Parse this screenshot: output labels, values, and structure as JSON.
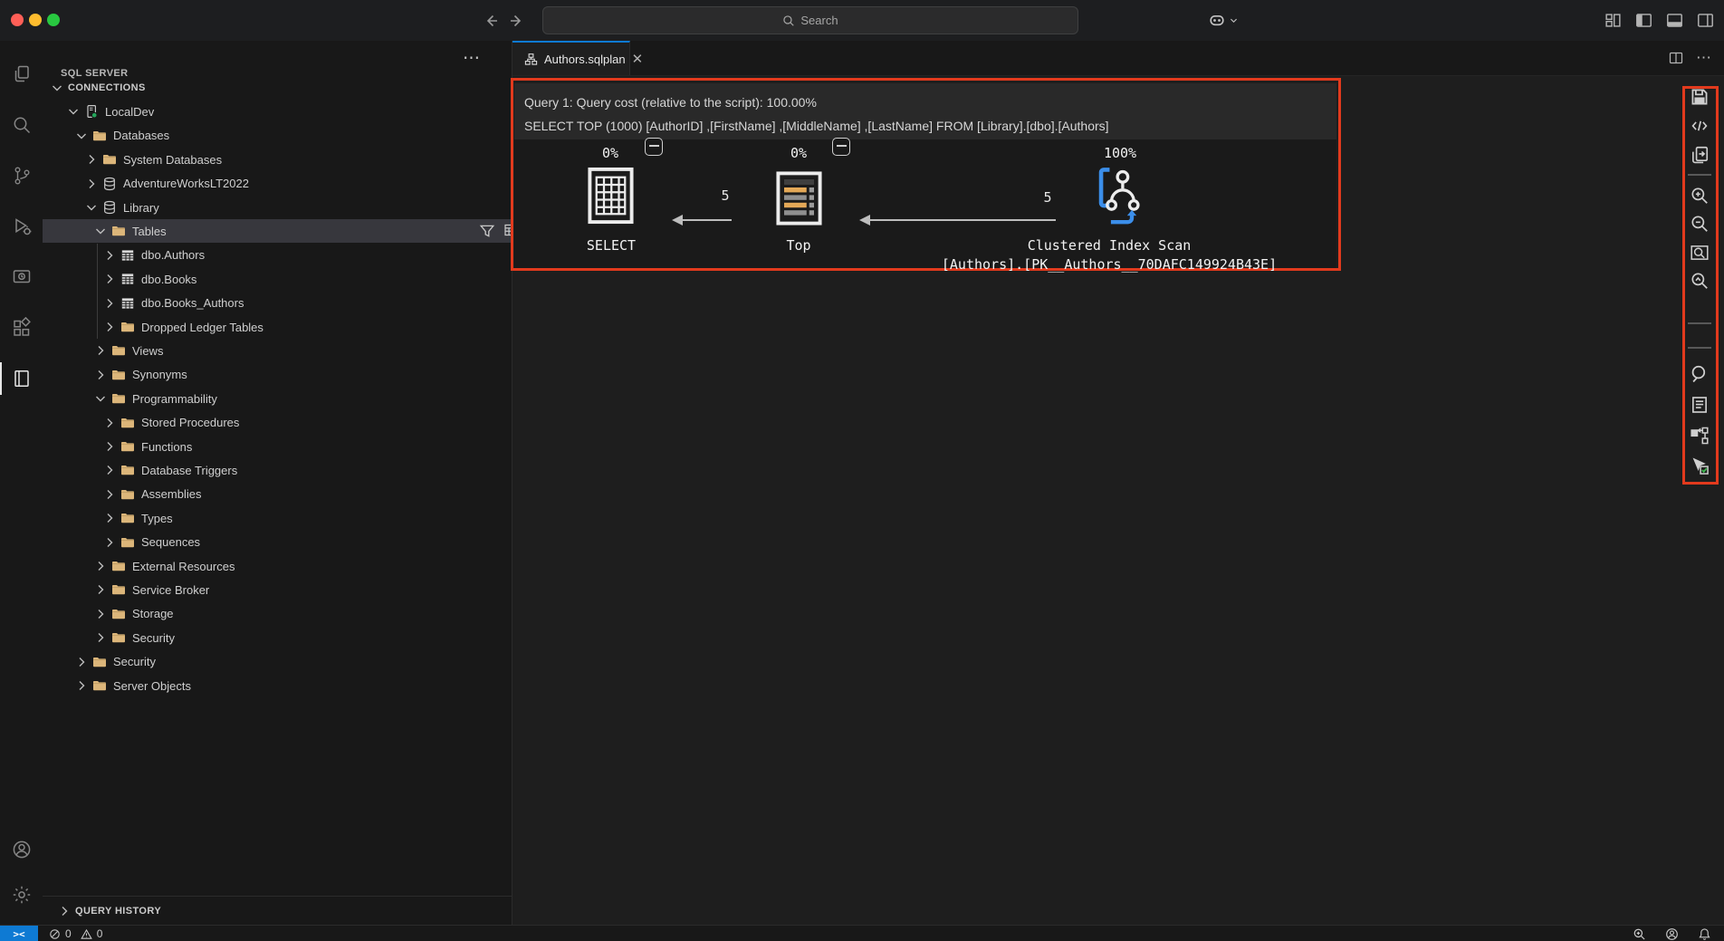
{
  "colors": {
    "annotation_red": "#e23a1d",
    "accent_blue": "#0e7ad3",
    "folder_tan": "#dcb67a",
    "connected_green": "#23a55a",
    "scan_blue": "#3b8eea"
  },
  "titlebar": {
    "search_placeholder": "Search",
    "traffic_lights": [
      "close",
      "minimize",
      "zoom"
    ],
    "right_icons": [
      "customize-layout",
      "toggle-primary-sidebar",
      "toggle-panel",
      "toggle-secondary-sidebar"
    ],
    "copilot": "copilot-menu"
  },
  "activity_bar": {
    "items": [
      {
        "name": "connections",
        "active": false
      },
      {
        "name": "search",
        "active": false
      },
      {
        "name": "source-control",
        "active": false
      },
      {
        "name": "run-and-debug",
        "active": false
      },
      {
        "name": "task-history",
        "active": false
      },
      {
        "name": "extensions",
        "active": false
      },
      {
        "name": "notebooks",
        "active": true
      }
    ],
    "bottom_items": [
      {
        "name": "accounts"
      },
      {
        "name": "settings"
      }
    ]
  },
  "sidebar": {
    "title": "SQL SERVER",
    "tree": [
      {
        "label": "CONNECTIONS",
        "level": 0,
        "expand": "down",
        "icon": null,
        "section": true
      },
      {
        "label": "LocalDev",
        "level": 1,
        "expand": "down",
        "icon": "server"
      },
      {
        "label": "Databases",
        "level": 2,
        "expand": "down",
        "icon": "folder"
      },
      {
        "label": "System Databases",
        "level": 3,
        "expand": "right",
        "icon": "folder"
      },
      {
        "label": "AdventureWorksLT2022",
        "level": 3,
        "expand": "right",
        "icon": "database"
      },
      {
        "label": "Library",
        "level": 3,
        "expand": "down",
        "icon": "database"
      },
      {
        "label": "Tables",
        "level": 4,
        "expand": "down",
        "icon": "folder",
        "selected": true,
        "actions": true
      },
      {
        "label": "dbo.Authors",
        "level": 5,
        "expand": "right",
        "icon": "table"
      },
      {
        "label": "dbo.Books",
        "level": 5,
        "expand": "right",
        "icon": "table"
      },
      {
        "label": "dbo.Books_Authors",
        "level": 5,
        "expand": "right",
        "icon": "table"
      },
      {
        "label": "Dropped Ledger Tables",
        "level": 5,
        "expand": "right",
        "icon": "folder"
      },
      {
        "label": "Views",
        "level": 4,
        "expand": "right",
        "icon": "folder"
      },
      {
        "label": "Synonyms",
        "level": 4,
        "expand": "right",
        "icon": "folder"
      },
      {
        "label": "Programmability",
        "level": 4,
        "expand": "down",
        "icon": "folder"
      },
      {
        "label": "Stored Procedures",
        "level": 5,
        "expand": "right",
        "icon": "folder"
      },
      {
        "label": "Functions",
        "level": 5,
        "expand": "right",
        "icon": "folder"
      },
      {
        "label": "Database Triggers",
        "level": 5,
        "expand": "right",
        "icon": "folder"
      },
      {
        "label": "Assemblies",
        "level": 5,
        "expand": "right",
        "icon": "folder"
      },
      {
        "label": "Types",
        "level": 5,
        "expand": "right",
        "icon": "folder"
      },
      {
        "label": "Sequences",
        "level": 5,
        "expand": "right",
        "icon": "folder"
      },
      {
        "label": "External Resources",
        "level": 4,
        "expand": "right",
        "icon": "folder"
      },
      {
        "label": "Service Broker",
        "level": 4,
        "expand": "right",
        "icon": "folder"
      },
      {
        "label": "Storage",
        "level": 4,
        "expand": "right",
        "icon": "folder"
      },
      {
        "label": "Security",
        "level": 4,
        "expand": "right",
        "icon": "folder"
      },
      {
        "label": "Security",
        "level": 2,
        "expand": "right",
        "icon": "folder"
      },
      {
        "label": "Server Objects",
        "level": 2,
        "expand": "right",
        "icon": "folder"
      }
    ],
    "selected_row_actions": [
      "filter",
      "new-table",
      "refresh"
    ],
    "bottom_panel": {
      "label": "QUERY HISTORY"
    }
  },
  "editor": {
    "tab": {
      "label": "Authors.sqlplan",
      "icon": "query-plan"
    },
    "tab_actions": [
      "split-editor",
      "more-actions"
    ],
    "plan": {
      "header_line1": "Query 1: Query cost (relative to the script): 100.00%",
      "header_line2": "SELECT TOP (1000) [AuthorID] ,[FirstName] ,[MiddleName] ,[LastName] FROM [Library].[dbo].[Authors]",
      "nodes": [
        {
          "cost": "0%",
          "label": "SELECT",
          "icon": "select-result"
        },
        {
          "cost": "0%",
          "label": "Top",
          "icon": "top-operator"
        },
        {
          "cost": "100%",
          "label": "Clustered Index Scan",
          "sublabel": "[Authors].[PK__Authors__70DAFC149924B43E]",
          "icon": "clustered-index-scan"
        }
      ],
      "edges": [
        {
          "rows": "5"
        },
        {
          "rows": "5"
        }
      ]
    },
    "toolbar": {
      "items": [
        {
          "name": "save-plan"
        },
        {
          "name": "open-plan-xml"
        },
        {
          "name": "open-query"
        },
        {
          "name": "divider"
        },
        {
          "name": "zoom-in"
        },
        {
          "name": "zoom-out"
        },
        {
          "name": "zoom-to-fit"
        },
        {
          "name": "custom-zoom"
        },
        {
          "name": "divider"
        },
        {
          "name": "divider"
        },
        {
          "name": "find-node"
        },
        {
          "name": "properties"
        },
        {
          "name": "compare-plan"
        },
        {
          "name": "actual-plan"
        }
      ]
    }
  },
  "status_bar": {
    "error_count": "0",
    "warning_count": "0",
    "right_icons": [
      "zoom-status",
      "account",
      "notifications-bell"
    ]
  }
}
